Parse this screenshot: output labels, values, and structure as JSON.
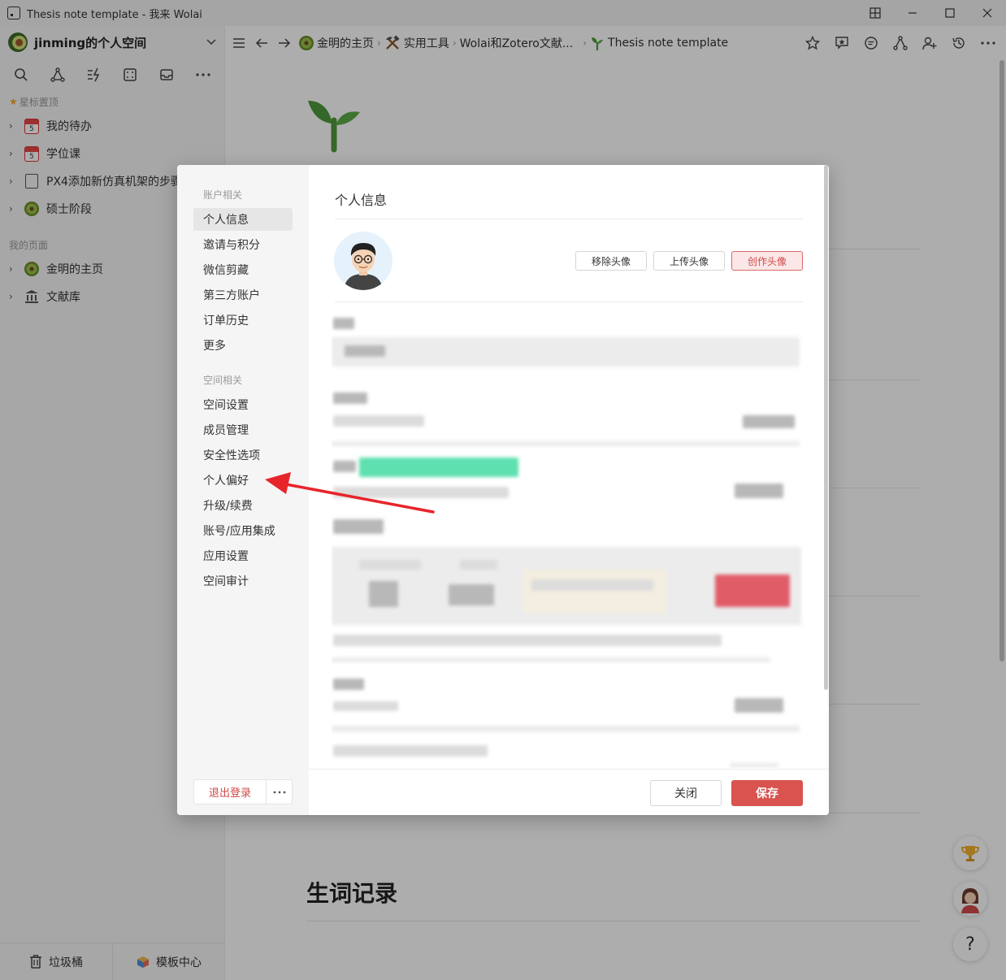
{
  "window": {
    "title": "Thesis note template - 我来 Wolai"
  },
  "sidebar": {
    "space_name": "jinming的个人空间",
    "starred_label": "星标置顶",
    "starred_items": [
      {
        "label": "我的待办"
      },
      {
        "label": "学位课"
      },
      {
        "label": "PX4添加新仿真机架的步骤"
      },
      {
        "label": "硕士阶段"
      }
    ],
    "my_pages_label": "我的页面",
    "my_pages": [
      {
        "label": "金明的主页"
      },
      {
        "label": "文献库"
      }
    ],
    "calendar_day": "5",
    "footer": {
      "trash": "垃圾桶",
      "templates": "模板中心"
    }
  },
  "breadcrumb": [
    {
      "label": "金明的主页"
    },
    {
      "label": "实用工具"
    },
    {
      "label": "Wolai和Zotero文献..."
    },
    {
      "label": "Thesis note template"
    }
  ],
  "page": {
    "vocab_heading": "生词记录"
  },
  "modal": {
    "account_section": "账户相关",
    "account_items": [
      "个人信息",
      "邀请与积分",
      "微信剪藏",
      "第三方账户",
      "订单历史",
      "更多"
    ],
    "space_section": "空间相关",
    "space_items": [
      "空间设置",
      "成员管理",
      "安全性选项",
      "个人偏好",
      "升级/续费",
      "账号/应用集成",
      "应用设置",
      "空间审计"
    ],
    "logout": "退出登录",
    "title": "个人信息",
    "avatar_buttons": {
      "remove": "移除头像",
      "upload": "上传头像",
      "create": "创作头像"
    },
    "close": "关闭",
    "save": "保存"
  },
  "colors": {
    "accent": "#d9534f",
    "annotation_arrow": "#e8242b"
  }
}
